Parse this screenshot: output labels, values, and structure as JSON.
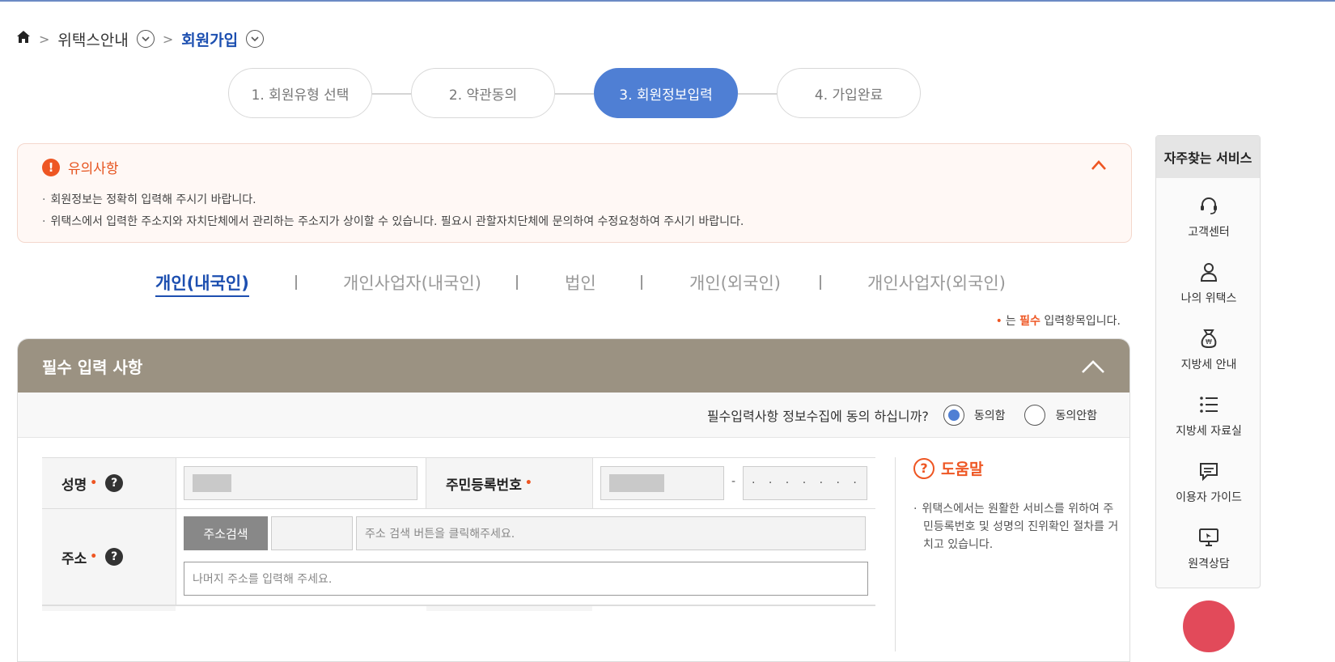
{
  "breadcrumb": {
    "home_icon": "home-icon",
    "items": [
      "위택스안내",
      "회원가입"
    ]
  },
  "steps": [
    {
      "label": "1. 회원유형 선택",
      "active": false
    },
    {
      "label": "2. 약관동의",
      "active": false
    },
    {
      "label": "3. 회원정보입력",
      "active": true
    },
    {
      "label": "4. 가입완료",
      "active": false
    }
  ],
  "notice": {
    "title": "유의사항",
    "items": [
      "회원정보는 정확히 입력해 주시기 바랍니다.",
      "위택스에서 입력한 주소지와 자치단체에서 관리하는 주소지가 상이할 수 있습니다. 필요시 관할자치단체에 문의하여 수정요청하여 주시기 바랍니다."
    ]
  },
  "member_tabs": [
    {
      "label": "개인(내국인)",
      "active": true
    },
    {
      "label": "개인사업자(내국인)",
      "active": false
    },
    {
      "label": "법인",
      "active": false
    },
    {
      "label": "개인(외국인)",
      "active": false
    },
    {
      "label": "개인사업자(외국인)",
      "active": false
    }
  ],
  "required_note": {
    "dot": "•",
    "prefix": "는 ",
    "required": "필수",
    "suffix": " 입력항목입니다."
  },
  "panel": {
    "title": "필수 입력 사항",
    "consent_question": "필수입력사항 정보수집에 동의 하십니까?",
    "agree_label": "동의함",
    "disagree_label": "동의안함",
    "agree_selected": true
  },
  "form": {
    "name_label": "성명",
    "rrn_label": "주민등록번호",
    "rrn_back_masked": "· · · · · · ·",
    "rrn_dash": "-",
    "address_label": "주소",
    "address_search_button": "주소검색",
    "address_placeholder": "주소 검색 버튼을 클릭해주세요.",
    "address_detail_placeholder": "나머지 주소를 입력해 주세요.",
    "required_dot": "•",
    "help_mark": "?"
  },
  "help": {
    "title": "도움말",
    "text": "위택스에서는 원활한 서비스를 위하여 주민등록번호 및 성명의 진위확인 절차를 거치고 있습니다."
  },
  "quick_menu": {
    "title": "자주찾는 서비스",
    "items": [
      {
        "label": "고객센터",
        "icon": "headset-icon"
      },
      {
        "label": "나의 위택스",
        "icon": "user-icon"
      },
      {
        "label": "지방세 안내",
        "icon": "money-bag-icon"
      },
      {
        "label": "지방세 자료실",
        "icon": "list-icon"
      },
      {
        "label": "이용자 가이드",
        "icon": "chat-icon"
      },
      {
        "label": "원격상담",
        "icon": "monitor-icon"
      }
    ]
  },
  "colors": {
    "accent_blue": "#4f7fd4",
    "link_blue": "#1d4fb0",
    "orange": "#ee5623",
    "panel_head": "#9b9282"
  }
}
